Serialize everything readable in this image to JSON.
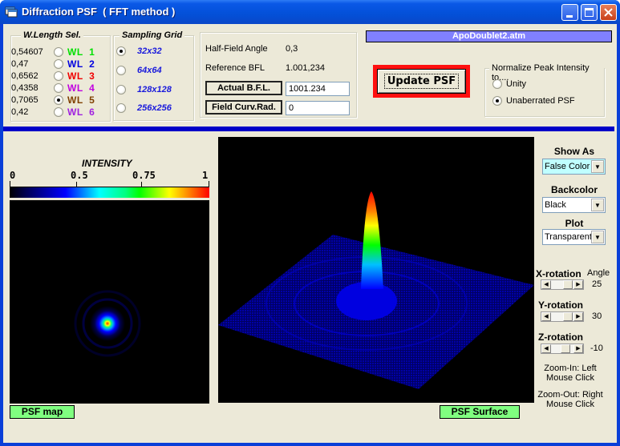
{
  "window": {
    "title": "Diffraction PSF  ( FFT method )",
    "icon": "app-window-icon",
    "controls": [
      "minimize-icon",
      "maximize-icon",
      "close-icon"
    ]
  },
  "wavelength_select": {
    "legend": "W.Length Sel.",
    "items": [
      {
        "value": "0,54607",
        "label": "WL  1",
        "color": "#00e000",
        "checked": false
      },
      {
        "value": "0,47",
        "label": "WL  2",
        "color": "#0000e0",
        "checked": false
      },
      {
        "value": "0,6562",
        "label": "WL  3",
        "color": "#f00000",
        "checked": false
      },
      {
        "value": "0,4358",
        "label": "WL  4",
        "color": "#c000e0",
        "checked": false
      },
      {
        "value": "0,7065",
        "label": "WL  5",
        "color": "#804000",
        "checked": true
      },
      {
        "value": "0,42",
        "label": "WL  6",
        "color": "#a020e0",
        "checked": false
      }
    ]
  },
  "sampling_grid": {
    "legend": "Sampling Grid",
    "items": [
      {
        "label": "32x32",
        "checked": true
      },
      {
        "label": "64x64",
        "checked": false
      },
      {
        "label": "128x128",
        "checked": false
      },
      {
        "label": "256x256",
        "checked": false
      }
    ]
  },
  "params": {
    "half_field_angle_label": "Half-Field Angle",
    "half_field_angle_value": "0,3",
    "reference_bfl_label": "Reference BFL",
    "reference_bfl_value": "1.001,234",
    "actual_bfl_button": "Actual  B.F.L.",
    "actual_bfl_value": "1001.234",
    "field_curv_button": "Field Curv.Rad.",
    "field_curv_value": "0"
  },
  "file_name": "ApoDoublet2.atm",
  "update_button": "Update PSF",
  "normalize": {
    "legend": "Normalize Peak Intensity to....",
    "options": [
      {
        "label": "Unity",
        "checked": false
      },
      {
        "label": "Unaberrated PSF",
        "checked": true
      }
    ]
  },
  "colorbar": {
    "title": "INTENSITY",
    "ticks": [
      "0",
      "0.5",
      "0.75",
      "1"
    ],
    "tick_values": [
      0,
      0.33,
      0.66,
      1.0
    ]
  },
  "psf_map_label": "PSF map",
  "psf_surface_label": "PSF Surface",
  "side_panel": {
    "show_as": {
      "title": "Show As",
      "value": "False Color"
    },
    "backcolor": {
      "title": "Backcolor",
      "value": "Black"
    },
    "plot": {
      "title": "Plot",
      "value": "Transparent"
    },
    "angle_header": "Angle",
    "rotations": [
      {
        "label": "X-rotation",
        "value": "25"
      },
      {
        "label": "Y-rotation",
        "value": "30"
      },
      {
        "label": "Z-rotation",
        "value": "-10"
      }
    ],
    "zoom_in_note_1": "Zoom-In: Left",
    "zoom_in_note_2": "Mouse  Click",
    "zoom_out_note_1": "Zoom-Out: Right",
    "zoom_out_note_2": "Mouse  Click"
  }
}
